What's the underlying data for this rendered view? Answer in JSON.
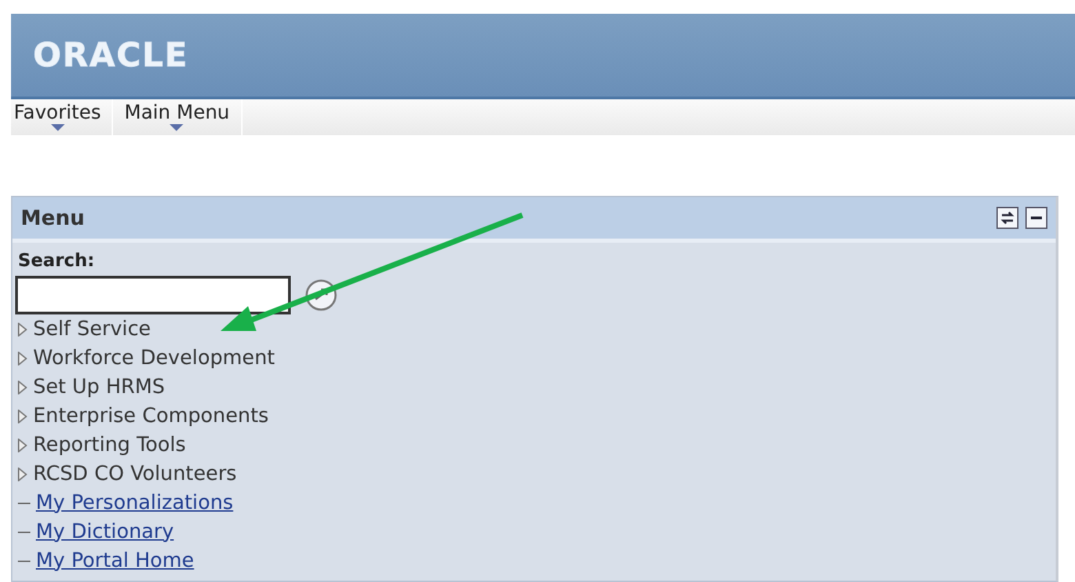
{
  "header": {
    "logo": "ORACLE"
  },
  "nav": [
    {
      "label": "Favorites"
    },
    {
      "label": "Main Menu"
    }
  ],
  "menu": {
    "title": "Menu",
    "search": {
      "label": "Search:"
    },
    "items": [
      {
        "kind": "folder",
        "label": "Self Service"
      },
      {
        "kind": "folder",
        "label": "Workforce Development"
      },
      {
        "kind": "folder",
        "label": "Set Up HRMS"
      },
      {
        "kind": "folder",
        "label": "Enterprise Components"
      },
      {
        "kind": "folder",
        "label": "Reporting Tools"
      },
      {
        "kind": "folder",
        "label": "RCSD CO Volunteers"
      },
      {
        "kind": "link",
        "label": "My Personalizations"
      },
      {
        "kind": "link",
        "label": "My Dictionary"
      },
      {
        "kind": "link",
        "label": "My Portal Home"
      }
    ]
  }
}
